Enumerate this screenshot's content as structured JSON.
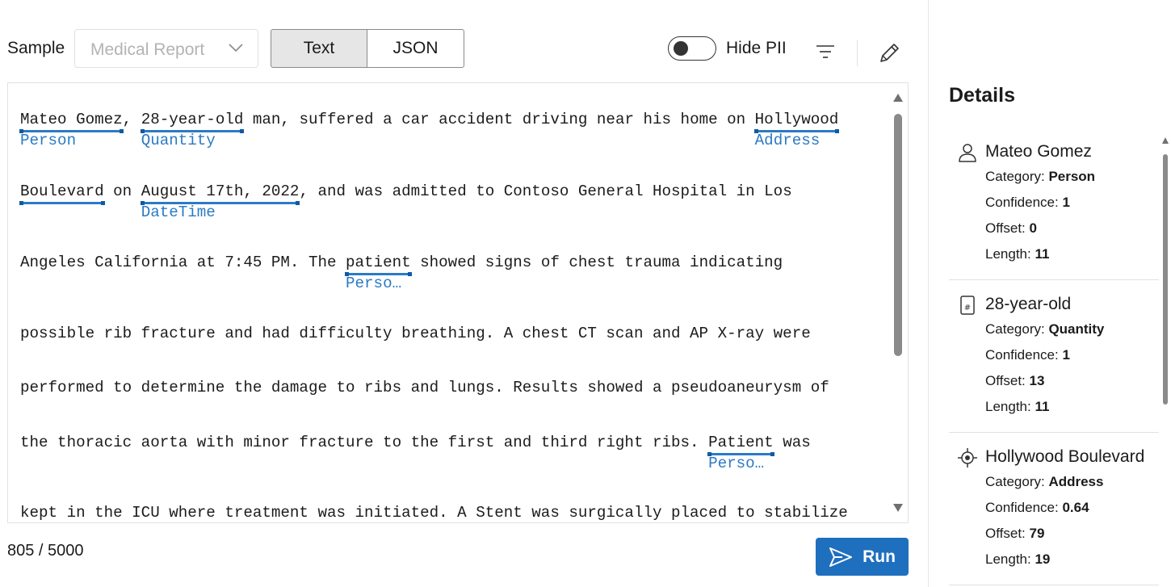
{
  "toolbar": {
    "sample_label": "Sample",
    "sample_value": "Medical Report",
    "view_text": "Text",
    "view_json": "JSON",
    "active_view": "Text",
    "hide_pii_label": "Hide PII",
    "hide_pii_enabled": false
  },
  "editor": {
    "lines": [
      {
        "segments": [
          {
            "text": "Mateo Gomez",
            "entity": "Person"
          },
          {
            "text": ", "
          },
          {
            "text": "28-year-old",
            "entity": "Quantity"
          },
          {
            "text": " man, suffered a car accident driving near his home on "
          },
          {
            "text": "Hollywood",
            "entity": "Address"
          }
        ]
      },
      {
        "segments": [
          {
            "text": "Boulevard",
            "entity": ""
          },
          {
            "text": " on "
          },
          {
            "text": "August 17th, 2022",
            "entity": "DateTime"
          },
          {
            "text": ", and was admitted to Contoso General Hospital in Los"
          }
        ]
      },
      {
        "segments": [
          {
            "text": "Angeles California at 7:45 PM. The "
          },
          {
            "text": "patient",
            "entity": "Perso…"
          },
          {
            "text": " showed signs of chest trauma indicating"
          }
        ]
      },
      {
        "segments": [
          {
            "text": "possible rib fracture and had difficulty breathing. A chest CT scan and AP X-ray were"
          }
        ]
      },
      {
        "segments": [
          {
            "text": "performed to determine the damage to ribs and lungs. Results showed a pseudoaneurysm of"
          }
        ]
      },
      {
        "segments": [
          {
            "text": "the thoracic aorta with minor fracture to the first and third right ribs. "
          },
          {
            "text": "Patient",
            "entity": "Perso…"
          },
          {
            "text": " was"
          }
        ]
      },
      {
        "segments": [
          {
            "text": "kept in the ICU where treatment was initiated. A Stent was surgically placed to stabilize"
          }
        ]
      }
    ]
  },
  "footer": {
    "char_count": "805 / 5000",
    "run_label": "Run"
  },
  "details": {
    "title": "Details",
    "category_label": "Category: ",
    "confidence_label": "Confidence: ",
    "offset_label": "Offset: ",
    "length_label": "Length: ",
    "items": [
      {
        "name": "Mateo Gomez",
        "icon": "person-icon",
        "category": "Person",
        "confidence": "1",
        "offset": "0",
        "length": "11"
      },
      {
        "name": "28-year-old",
        "icon": "quantity-icon",
        "category": "Quantity",
        "confidence": "1",
        "offset": "13",
        "length": "11"
      },
      {
        "name": "Hollywood Boulevard",
        "icon": "location-icon",
        "category": "Address",
        "confidence": "0.64",
        "offset": "79",
        "length": "19"
      }
    ]
  },
  "colors": {
    "accent": "#1f6fbf",
    "entity_label": "#2b7ac4",
    "selected_segment": "#e6e6e6"
  }
}
